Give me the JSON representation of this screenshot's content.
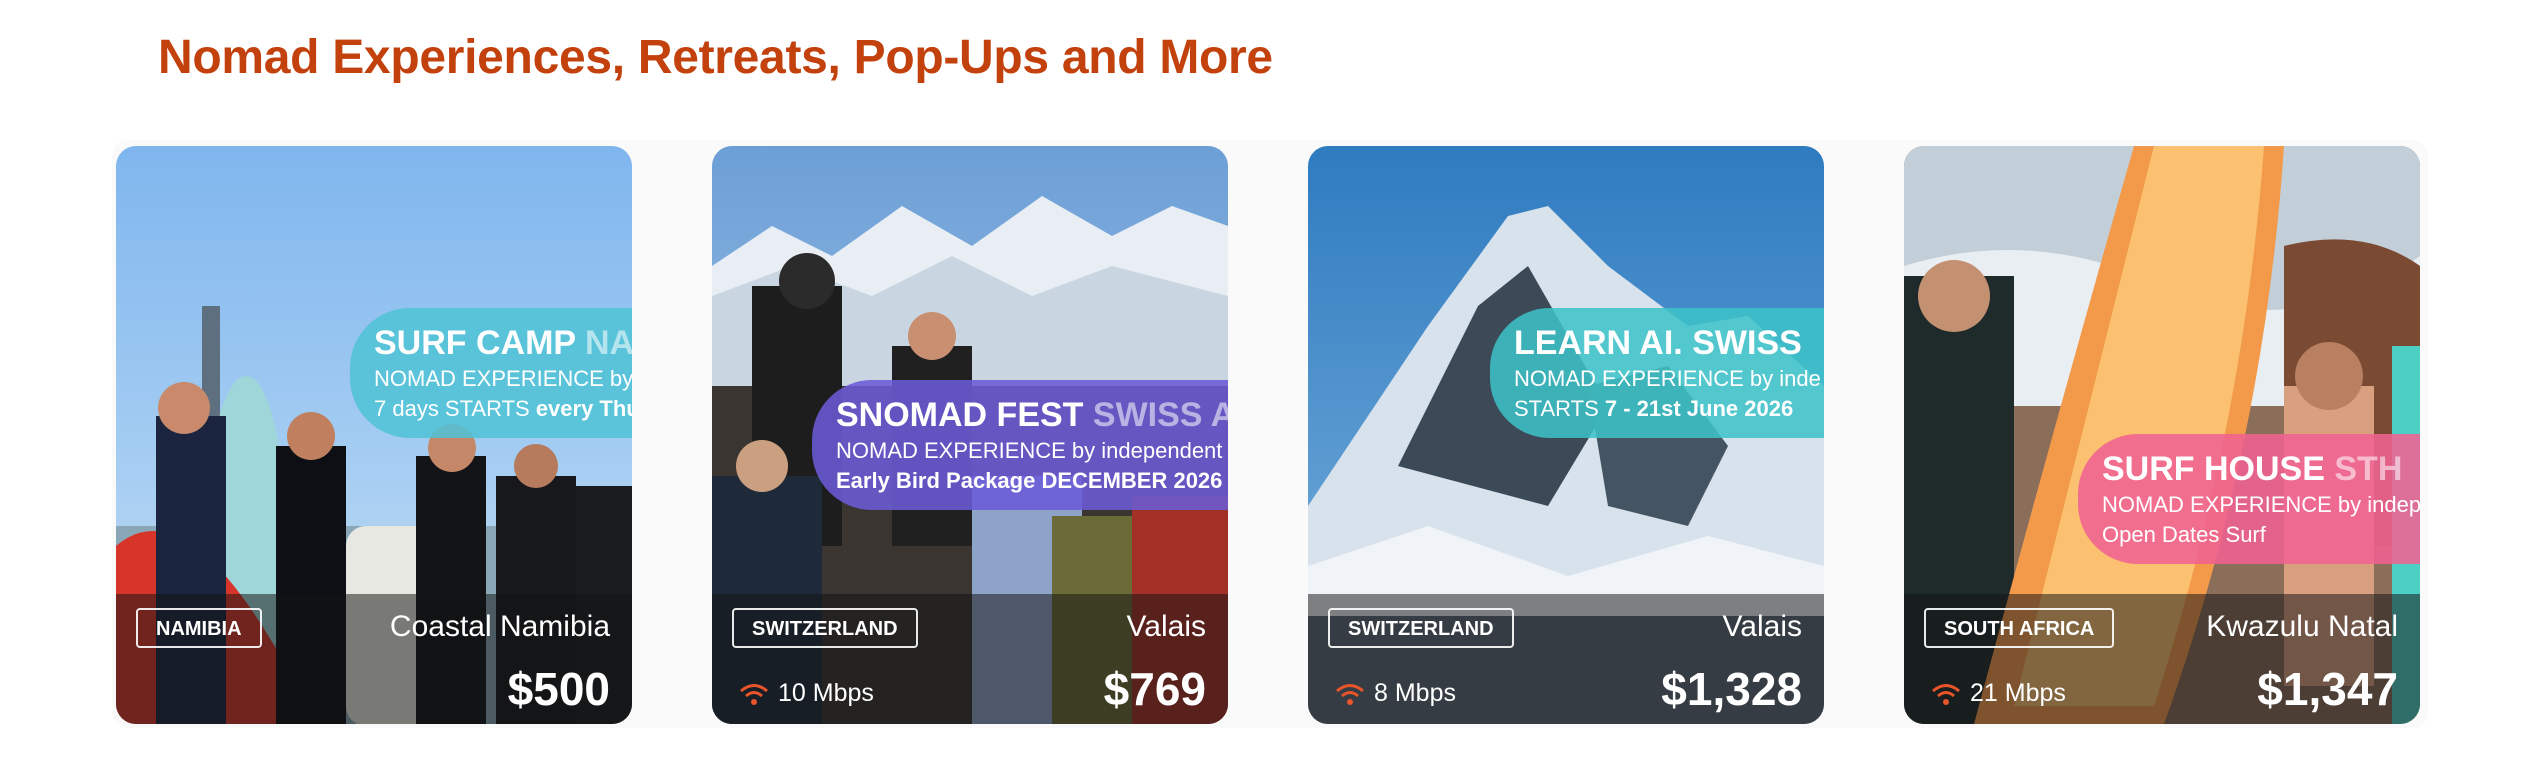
{
  "section": {
    "title": "Nomad Experiences, Retreats, Pop-Ups and More"
  },
  "cards": [
    {
      "country": "NAMIBIA",
      "city": "Coastal Namibia",
      "price": "$500",
      "speed": "",
      "promo": {
        "title": "SURF CAMP",
        "title_faded": "NA",
        "line1": "NOMAD EXPERIENCE by in",
        "line2_prefix": "7 days STARTS ",
        "line2_bold": "every Thu"
      }
    },
    {
      "country": "SWITZERLAND",
      "city": "Valais",
      "price": "$769",
      "speed": "10 Mbps",
      "promo": {
        "title": "SNOMAD FEST",
        "title_faded": "SWISS A",
        "line1": "NOMAD EXPERIENCE by independent",
        "line2_prefix": "",
        "line2_bold": "Early Bird Package DECEMBER 2026"
      }
    },
    {
      "country": "SWITZERLAND",
      "city": "Valais",
      "price": "$1,328",
      "speed": "8 Mbps",
      "promo": {
        "title": "LEARN AI.",
        "title_faded": "SWISS",
        "line1": "NOMAD EXPERIENCE by inde",
        "line2_prefix": "STARTS ",
        "line2_bold": "7 - 21st June 2026"
      }
    },
    {
      "country": "SOUTH AFRICA",
      "city": "Kwazulu Natal",
      "price": "$1,347",
      "speed": "21 Mbps",
      "promo": {
        "title": "SURF HOUSE",
        "title_faded": "STH",
        "line1": "NOMAD EXPERIENCE by indep",
        "line2_prefix": "Open Dates Surf",
        "line2_bold": ""
      }
    }
  ],
  "colors": {
    "title": "#c2410c",
    "wifi_icon": "#e8552a",
    "promo_cyan": "#4fc3d6",
    "promo_purple": "#6b5bd6",
    "promo_teal": "#3cc3c8",
    "promo_pink": "#f06292"
  },
  "icons": {
    "speed": "wifi-icon"
  }
}
